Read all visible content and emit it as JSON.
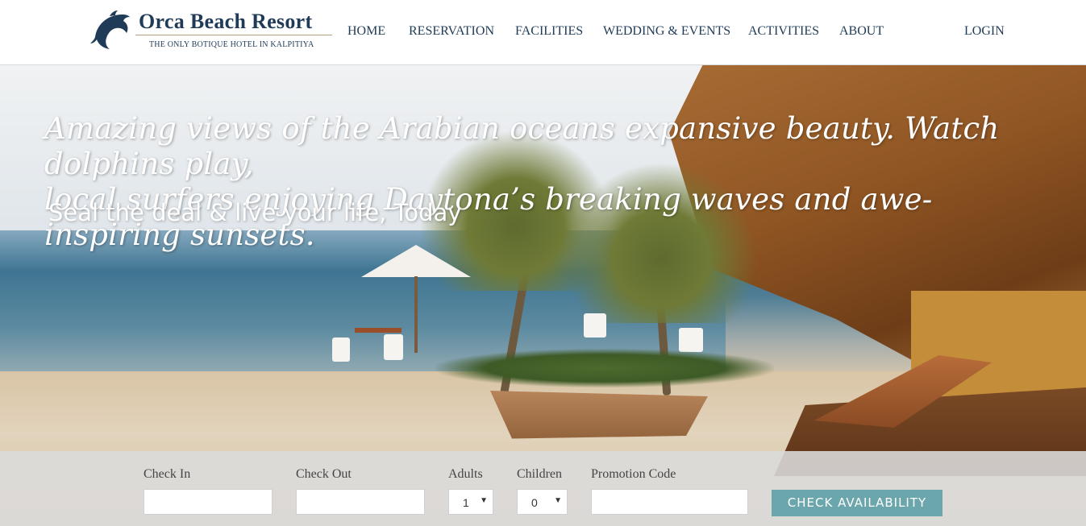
{
  "brand": {
    "name": "Orca Beach Resort",
    "tagline": "THE ONLY BOTIQUE HOTEL IN KALPITIYA",
    "accent": "#1f3b57"
  },
  "nav": {
    "items": [
      "HOME",
      "RESERVATION",
      "FACILITIES",
      "WEDDING & EVENTS",
      "ACTIVITIES",
      "ABOUT"
    ],
    "login": "LOGIN"
  },
  "hero": {
    "headline_line1": "Amazing views of the Arabian oceans expansive beauty. Watch dolphins play,",
    "headline_line2": "local surfers enjoying Daytona’s breaking waves and awe-inspiring sunsets.",
    "subline": "Seal the deal & live your life, Today"
  },
  "booking": {
    "check_in_label": "Check In",
    "check_in_value": "",
    "check_out_label": "Check Out",
    "check_out_value": "",
    "adults_label": "Adults",
    "adults_value": "1",
    "children_label": "Children",
    "children_value": "0",
    "promo_label": "Promotion Code",
    "promo_value": "",
    "button_label": "CHECK AVAILABILITY",
    "button_color": "#6aa6ac"
  }
}
